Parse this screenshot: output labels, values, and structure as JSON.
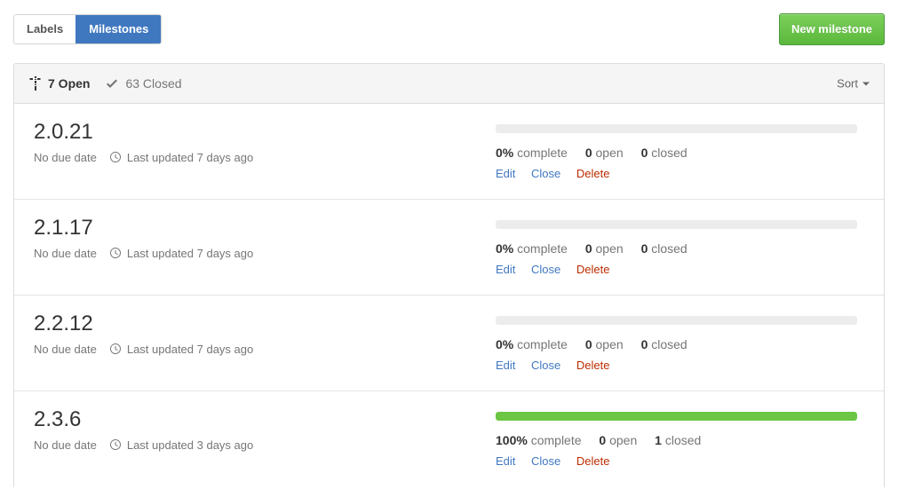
{
  "tabs": [
    {
      "label": "Labels",
      "selected": false
    },
    {
      "label": "Milestones",
      "selected": true
    }
  ],
  "new_milestone_button": "New milestone",
  "filters": {
    "open": {
      "count": "7",
      "label": "7 Open",
      "icon": "milestone-icon"
    },
    "closed": {
      "count": "63",
      "label": "63 Closed",
      "icon": "check-icon"
    },
    "sort": "Sort"
  },
  "actions": {
    "edit": "Edit",
    "close": "Close",
    "delete": "Delete"
  },
  "labels": {
    "complete_suffix": "complete",
    "open_suffix": "open",
    "closed_suffix": "closed",
    "no_due_date": "No due date"
  },
  "colors": {
    "accent_blue": "#4078c0",
    "green": "#6cc644",
    "danger_red": "#bd2c00",
    "muted": "#767676",
    "progress_track": "#ececec"
  },
  "milestones": [
    {
      "title": "2.0.21",
      "due": "No due date",
      "updated": "Last updated 7 days ago",
      "percent": "0%",
      "percent_value": 0,
      "open": "0",
      "closed": "0",
      "complete_label": "complete",
      "open_label": "open",
      "closed_label": "closed"
    },
    {
      "title": "2.1.17",
      "due": "No due date",
      "updated": "Last updated 7 days ago",
      "percent": "0%",
      "percent_value": 0,
      "open": "0",
      "closed": "0",
      "complete_label": "complete",
      "open_label": "open",
      "closed_label": "closed"
    },
    {
      "title": "2.2.12",
      "due": "No due date",
      "updated": "Last updated 7 days ago",
      "percent": "0%",
      "percent_value": 0,
      "open": "0",
      "closed": "0",
      "complete_label": "complete",
      "open_label": "open",
      "closed_label": "closed"
    },
    {
      "title": "2.3.6",
      "due": "No due date",
      "updated": "Last updated 3 days ago",
      "percent": "100%",
      "percent_value": 100,
      "open": "0",
      "closed": "1",
      "complete_label": "complete",
      "open_label": "open",
      "closed_label": "closed"
    }
  ]
}
